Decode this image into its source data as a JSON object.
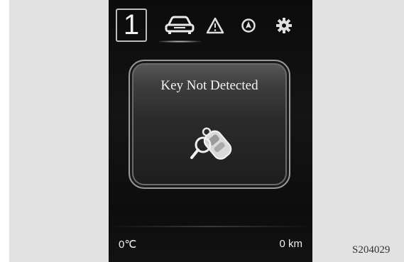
{
  "header": {
    "gear_indicator": "1",
    "icons": [
      "car-icon",
      "warning-triangle-icon",
      "navigation-compass-icon",
      "settings-gear-icon"
    ]
  },
  "message": {
    "title": "Key Not Detected",
    "icon": "smart-key-search-icon"
  },
  "footer": {
    "temperature": "0℃",
    "distance": "0 km"
  },
  "figure_id": "S204029"
}
